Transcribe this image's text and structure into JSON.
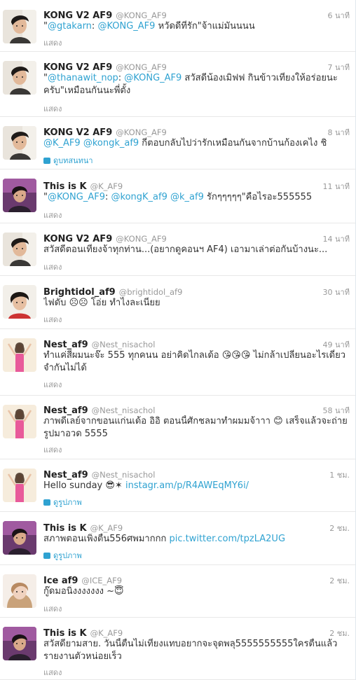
{
  "tweets": [
    {
      "name": "KONG V2 AF9",
      "handle": "@KONG_AF9",
      "time": "6 นาที",
      "parts": [
        {
          "t": "\"",
          "link": false
        },
        {
          "t": "@gtakarn",
          "link": true
        },
        {
          "t": ": ",
          "link": false
        },
        {
          "t": "@KONG_AF9",
          "link": true
        },
        {
          "t": " หวัดดีที่รัก\"จ้าแม่มันนนน",
          "link": false
        }
      ],
      "expand": "แสดง"
    },
    {
      "name": "KONG V2 AF9",
      "handle": "@KONG_AF9",
      "time": "7 นาที",
      "parts": [
        {
          "t": "\"",
          "link": false
        },
        {
          "t": "@thanawit_nop",
          "link": true
        },
        {
          "t": ": ",
          "link": false
        },
        {
          "t": "@KONG_AF9",
          "link": true
        },
        {
          "t": " สวัสดีน้องเมิฟฟ กินข้าวเที่ยงให้อร่อยนะครับ\"เหมือนกันนะพี่ตั้ง",
          "link": false
        }
      ],
      "expand": "แสดง"
    },
    {
      "name": "KONG V2 AF9",
      "handle": "@KONG_AF9",
      "time": "8 นาที",
      "parts": [
        {
          "t": "@K_AF9",
          "link": true
        },
        {
          "t": " ",
          "link": false
        },
        {
          "t": "@kongk_af9",
          "link": true
        },
        {
          "t": " กี่ตอบกลับไปว่ารักเหมือนกันจากบ้านก้องเคไง ชิ",
          "link": false
        }
      ],
      "action": "ดูบทสนทนา"
    },
    {
      "name": "This is K",
      "handle": "@K_AF9",
      "time": "11 นาที",
      "parts": [
        {
          "t": "\"",
          "link": false
        },
        {
          "t": "@KONG_AF9",
          "link": true
        },
        {
          "t": ": ",
          "link": false
        },
        {
          "t": "@kongK_af9",
          "link": true
        },
        {
          "t": " ",
          "link": false
        },
        {
          "t": "@k_af9",
          "link": true
        },
        {
          "t": " รักๆๆๆๆๆ\"คือไรอะ555555",
          "link": false
        }
      ],
      "expand": "แสดง"
    },
    {
      "name": "KONG V2 AF9",
      "handle": "@KONG_AF9",
      "time": "14 นาที",
      "parts": [
        {
          "t": "สวัสดีตอนเที่ยงจ้าทุกท่าน...(อยากดูคอนฯ AF4) เอามาเล่าต่อกันบ้างนะ...",
          "link": false
        }
      ],
      "expand": "แสดง"
    },
    {
      "name": "Brightidol_af9",
      "handle": "@brightidol_af9",
      "time": "30 นาที",
      "parts": [
        {
          "t": "ไฟดับ ☹☹ โอ่ย ทำไงละเนี่ยย",
          "link": false
        }
      ],
      "expand": "แสดง"
    },
    {
      "name": "Nest_af9",
      "handle": "@Nest_nisachol",
      "time": "49 นาที",
      "parts": [
        {
          "t": "ทำแค่สีผมนะจ๊ะ 555 ทุกคนน อย่าคิดไกลเด้อ 😘😘😘 ไม่กล้าเปลี่ยนอะไรเดี๋ยวจำกันไม่ได้",
          "link": false
        }
      ],
      "expand": "แสดง"
    },
    {
      "name": "Nest_af9",
      "handle": "@Nest_nisachol",
      "time": "58 นาที",
      "parts": [
        {
          "t": "ภาพดีเลย์จากขอนแก่นเด้อ อิอิ ตอนนี้ศักชลมาทำผมมจ้าาา 😊 เสร็จแล้วจะถ่ายรูปมาอวด 5555",
          "link": false
        }
      ],
      "expand": "แสดง"
    },
    {
      "name": "Nest_af9",
      "handle": "@Nest_nisachol",
      "time": "1 ชม.",
      "parts": [
        {
          "t": "Hello sunday 😎✶ ",
          "link": false
        },
        {
          "t": "instagr.am/p/R4AWEqMY6i/",
          "link": true
        }
      ],
      "action": "ดูรูปภาพ"
    },
    {
      "name": "This is K",
      "handle": "@K_AF9",
      "time": "2 ชม.",
      "parts": [
        {
          "t": "สภาพตอนเพิ่งตื่น556ศพมากกก ",
          "link": false
        },
        {
          "t": "pic.twitter.com/tpzLA2UG",
          "link": true
        }
      ],
      "action": "ดูรูปภาพ"
    },
    {
      "name": "Ice af9",
      "handle": "@ICE_AF9",
      "time": "2 ชม.",
      "parts": [
        {
          "t": "กู๊ดมอนิ่งงงงงงง ~😇",
          "link": false
        }
      ],
      "expand": "แสดง"
    },
    {
      "name": "This is K",
      "handle": "@K_AF9",
      "time": "2 ชม.",
      "parts": [
        {
          "t": "สวัสดียามสาย. วันนี้ตื่นไม่เที่ยงแทบอยากจะจุดพลุ5555555555ใครตื่นแล้วรายงานตัวหน่อยเร็ว",
          "link": false
        }
      ],
      "expand": "แสดง"
    }
  ],
  "colors": {
    "link": "#2fa2d1",
    "name": "#222222",
    "meta": "#999999",
    "divider": "#e8e8e8"
  }
}
